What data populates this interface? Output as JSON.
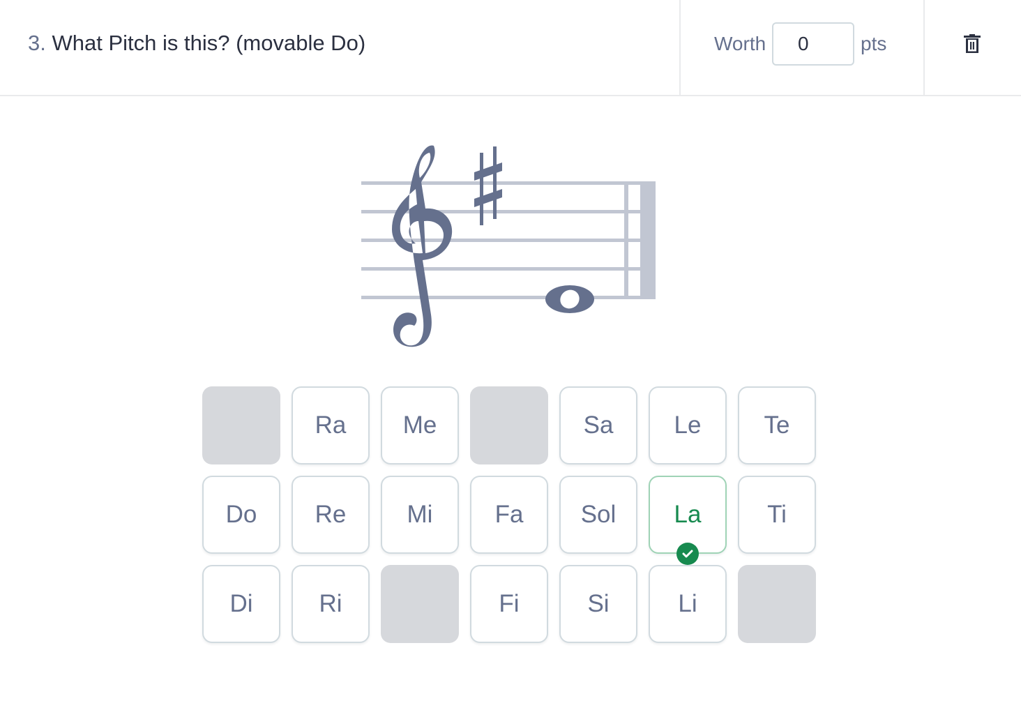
{
  "question": {
    "number": "3.",
    "title": "What Pitch is this? (movable Do)"
  },
  "worth": {
    "label": "Worth",
    "value": "0",
    "unit": "pts"
  },
  "delete": {
    "icon": "trash-icon",
    "label": "Delete question"
  },
  "notation": {
    "clef": "treble",
    "key_signature": [
      "F#"
    ],
    "note": "E4",
    "duration": "whole",
    "barline": "final",
    "colors": {
      "staff": "#c1c6d2",
      "glyph": "#65708d"
    }
  },
  "answer_grid": {
    "rows": [
      [
        {
          "label": ""
        },
        {
          "label": "Ra"
        },
        {
          "label": "Me"
        },
        {
          "label": ""
        },
        {
          "label": "Sa"
        },
        {
          "label": "Le"
        },
        {
          "label": "Te"
        }
      ],
      [
        {
          "label": "Do"
        },
        {
          "label": "Re"
        },
        {
          "label": "Mi"
        },
        {
          "label": "Fa"
        },
        {
          "label": "Sol"
        },
        {
          "label": "La",
          "correct": true
        },
        {
          "label": "Ti"
        }
      ],
      [
        {
          "label": "Di"
        },
        {
          "label": "Ri"
        },
        {
          "label": ""
        },
        {
          "label": "Fi"
        },
        {
          "label": "Si"
        },
        {
          "label": "Li"
        },
        {
          "label": ""
        }
      ]
    ],
    "selected": "La",
    "colors": {
      "correct": "#178a4f",
      "empty": "#d6d8dc",
      "text": "#65708d",
      "border": "#d1dadf"
    }
  }
}
